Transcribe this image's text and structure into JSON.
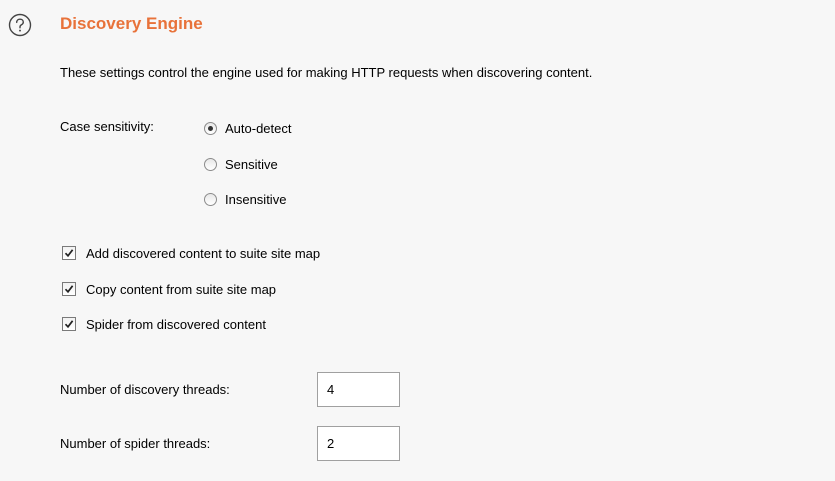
{
  "section": {
    "title": "Discovery Engine",
    "description": "These settings control the engine used for making HTTP requests when discovering content."
  },
  "case_sensitivity": {
    "label": "Case sensitivity:",
    "options": [
      {
        "label": "Auto-detect",
        "selected": true
      },
      {
        "label": "Sensitive",
        "selected": false
      },
      {
        "label": "Insensitive",
        "selected": false
      }
    ]
  },
  "checkboxes": [
    {
      "label": "Add discovered content to suite site map",
      "checked": true
    },
    {
      "label": "Copy content from suite site map",
      "checked": true
    },
    {
      "label": "Spider from discovered content",
      "checked": true
    }
  ],
  "fields": {
    "discovery_threads": {
      "label": "Number of discovery threads:",
      "value": "4"
    },
    "spider_threads": {
      "label": "Number of spider threads:",
      "value": "2"
    }
  },
  "colors": {
    "title": "#e8723a",
    "background": "#f7f7f7"
  },
  "icons": {
    "help": "question-circle-icon"
  }
}
